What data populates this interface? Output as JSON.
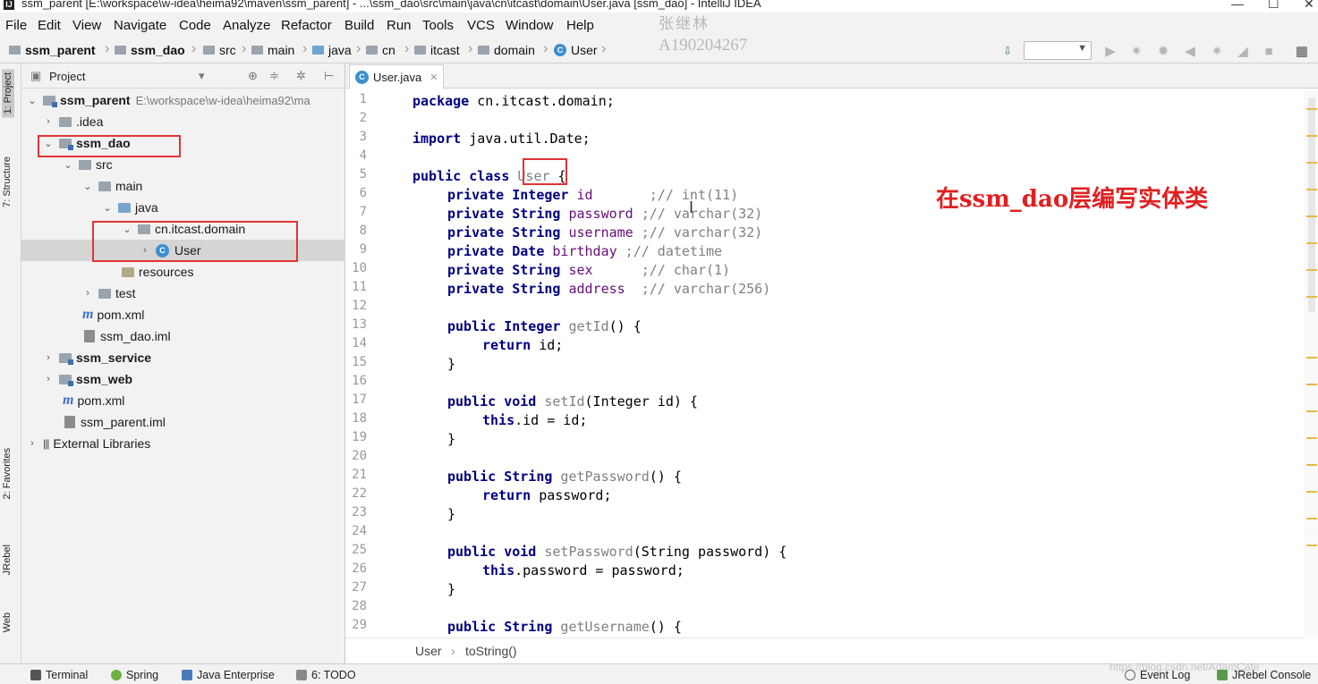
{
  "window": {
    "title": "ssm_parent [E:\\workspace\\w-idea\\heima92\\maven\\ssm_parent] - ...\\ssm_dao\\src\\main\\java\\cn\\itcast\\domain\\User.java [ssm_dao] - IntelliJ IDEA",
    "minimize": "—",
    "maximize": "☐",
    "close": "✕"
  },
  "menu": [
    "File",
    "Edit",
    "View",
    "Navigate",
    "Code",
    "Analyze",
    "Refactor",
    "Build",
    "Run",
    "Tools",
    "VCS",
    "Window",
    "Help"
  ],
  "watermark": {
    "name": "张继林",
    "id": "A190204267"
  },
  "breadcrumbs": [
    "ssm_parent",
    "ssm_dao",
    "src",
    "main",
    "java",
    "cn",
    "itcast",
    "domain",
    "User"
  ],
  "left_strip": [
    "1: Project",
    "7: Structure",
    "2: Favorites",
    "JRebel",
    "Web"
  ],
  "project_panel": {
    "title": "Project",
    "tree": [
      {
        "label": "ssm_parent",
        "path": "E:\\workspace\\w-idea\\heima92\\ma"
      },
      {
        "label": ".idea"
      },
      {
        "label": "ssm_dao"
      },
      {
        "label": "src"
      },
      {
        "label": "main"
      },
      {
        "label": "java"
      },
      {
        "label": "cn.itcast.domain"
      },
      {
        "label": "User"
      },
      {
        "label": "resources"
      },
      {
        "label": "test"
      },
      {
        "label": "pom.xml"
      },
      {
        "label": "ssm_dao.iml"
      },
      {
        "label": "ssm_service"
      },
      {
        "label": "ssm_web"
      },
      {
        "label": "pom.xml"
      },
      {
        "label": "ssm_parent.iml"
      },
      {
        "label": "External Libraries"
      }
    ]
  },
  "editor": {
    "tab_label": "User.java",
    "line_numbers": [
      "1",
      "2",
      "3",
      "4",
      "5",
      "6",
      "7",
      "8",
      "9",
      "10",
      "11",
      "12",
      "13",
      "14",
      "15",
      "16",
      "17",
      "18",
      "19",
      "20",
      "21",
      "22",
      "23",
      "24",
      "25",
      "26",
      "27",
      "28",
      "29"
    ],
    "code": {
      "l1_kw": "package",
      "l1_rest": " cn.itcast.domain;",
      "l3_kw": "import",
      "l3_rest": " java.util.Date;",
      "l5_kw": "public class",
      "l5_cls": "User",
      "l5_rest": " {",
      "private_kw": "private",
      "f1_type": "Integer",
      "f1_name": " id",
      "f1_comment": "       ;// int(11)",
      "f2_type": "String",
      "f2_name": " password",
      "f2_comment": " ;// varchar(32)",
      "f3_type": "String",
      "f3_name": " username",
      "f3_comment": " ;// varchar(32)",
      "f4_type": "Date",
      "f4_name": " birthday",
      "f4_comment": " ;// datetime",
      "f5_type": "String",
      "f5_name": " sex",
      "f5_comment": "      ;// char(1)",
      "f6_type": "String",
      "f6_name": " address",
      "f6_comment": "  ;// varchar(256)",
      "m1_sig": "public Integer",
      "m1_name": " getId",
      "m1_rest": "() {",
      "return_kw": "return",
      "m1_body": " id;",
      "close_brace": "}",
      "m2_sig": "public void",
      "m2_name": " setId",
      "m2_rest": "(Integer id) {",
      "this_kw": "this",
      "m2_body": ".id = id;",
      "m3_sig": "public String",
      "m3_name": " getPassword",
      "m3_rest": "() {",
      "m3_body": " password;",
      "m4_sig": "public void",
      "m4_name": " setPassword",
      "m4_rest": "(String password) {",
      "m4_body": ".password = password;",
      "m5_sig": "public String",
      "m5_name": " getUsername",
      "m5_rest": "() {"
    },
    "annotation": "在ssm_dao层编写实体类",
    "bottom_breadcrumb": {
      "class": "User",
      "method": "toString()"
    }
  },
  "status_bar": {
    "terminal": "Terminal",
    "spring": "Spring",
    "java_enterprise": "Java Enterprise",
    "todo": "6: TODO",
    "event_log": "Event Log",
    "jrebel_console": "JRebel Console",
    "watermark_url": "https://blog.csdn.net/AdamCafe"
  },
  "colors": {
    "keyword": "#000080",
    "comment": "#808080",
    "highlight_box": "#e03535",
    "annotation": "#e02020"
  }
}
